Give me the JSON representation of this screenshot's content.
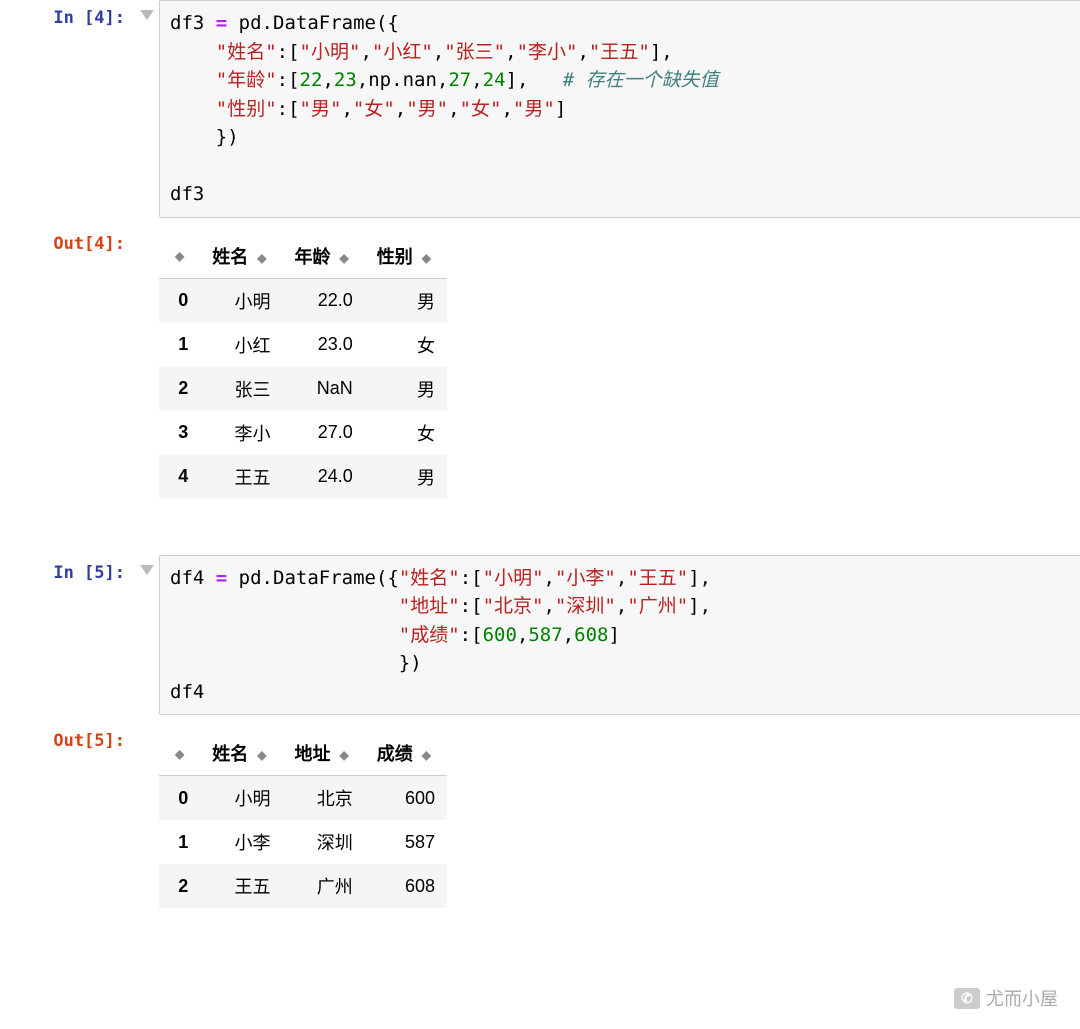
{
  "cells": {
    "c1": {
      "in_prompt": "In [4]:",
      "out_prompt": "Out[4]:",
      "code": {
        "l1_var": "df3",
        "l1_eq": " = ",
        "l1_pd": "pd",
        "l1_dot": ".",
        "l1_fn": "DataFrame",
        "l1_open": "({",
        "l2_indent": "    ",
        "l2_key": "\"姓名\"",
        "l2_colon": ":[",
        "l2_v1": "\"小明\"",
        "l2_c": ",",
        "l2_v2": "\"小红\"",
        "l2_v3": "\"张三\"",
        "l2_v4": "\"李小\"",
        "l2_v5": "\"王五\"",
        "l2_close": "],",
        "l3_key": "\"年龄\"",
        "l3_colon": ":[",
        "l3_v1": "22",
        "l3_v2": "23",
        "l3_np": "np",
        "l3_dot": ".",
        "l3_nan": "nan",
        "l3_v4": "27",
        "l3_v5": "24",
        "l3_close": "],   ",
        "l3_comment": "# 存在一个缺失值",
        "l4_key": "\"性别\"",
        "l4_colon": ":[",
        "l4_v1": "\"男\"",
        "l4_v2": "\"女\"",
        "l4_v3": "\"男\"",
        "l4_v4": "\"女\"",
        "l4_v5": "\"男\"",
        "l4_close": "]",
        "l5_close": "})",
        "l6_blank": "",
        "l7_var": "df3"
      },
      "table": {
        "headers": [
          "姓名",
          "年龄",
          "性别"
        ],
        "rows": [
          {
            "idx": "0",
            "c": [
              "小明",
              "22.0",
              "男"
            ]
          },
          {
            "idx": "1",
            "c": [
              "小红",
              "23.0",
              "女"
            ]
          },
          {
            "idx": "2",
            "c": [
              "张三",
              "NaN",
              "男"
            ]
          },
          {
            "idx": "3",
            "c": [
              "李小",
              "27.0",
              "女"
            ]
          },
          {
            "idx": "4",
            "c": [
              "王五",
              "24.0",
              "男"
            ]
          }
        ]
      }
    },
    "c2": {
      "in_prompt": "In [5]:",
      "out_prompt": "Out[5]:",
      "code": {
        "l1_var": "df4",
        "l1_eq": " = ",
        "l1_pd": "pd",
        "l1_dot": ".",
        "l1_fn": "DataFrame",
        "l1_open": "({",
        "l1_key": "\"姓名\"",
        "l1_colon": ":[",
        "l1_v1": "\"小明\"",
        "l1_c": ",",
        "l1_v2": "\"小李\"",
        "l1_v3": "\"王五\"",
        "l1_close": "],",
        "l2_indent": "                    ",
        "l2_key": "\"地址\"",
        "l2_colon": ":[",
        "l2_v1": "\"北京\"",
        "l2_v2": "\"深圳\"",
        "l2_v3": "\"广州\"",
        "l2_close": "],",
        "l3_key": "\"成绩\"",
        "l3_colon": ":[",
        "l3_v1": "600",
        "l3_v2": "587",
        "l3_v3": "608",
        "l3_close": "]",
        "l4_close": "})",
        "l5_var": "df4"
      },
      "table": {
        "headers": [
          "姓名",
          "地址",
          "成绩"
        ],
        "rows": [
          {
            "idx": "0",
            "c": [
              "小明",
              "北京",
              "600"
            ]
          },
          {
            "idx": "1",
            "c": [
              "小李",
              "深圳",
              "587"
            ]
          },
          {
            "idx": "2",
            "c": [
              "王五",
              "广州",
              "608"
            ]
          }
        ]
      }
    }
  },
  "sort_glyph": "◆",
  "watermark": "尤而小屋"
}
